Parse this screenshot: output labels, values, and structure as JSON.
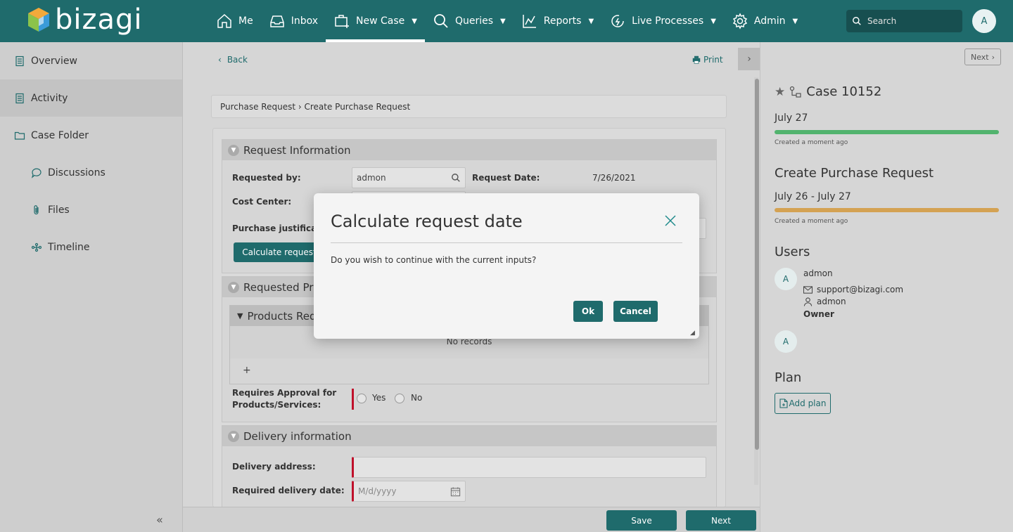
{
  "header": {
    "logo_text": "bizagi",
    "nav": [
      {
        "label": "Me",
        "icon": "home-icon",
        "caret": false
      },
      {
        "label": "Inbox",
        "icon": "inbox-icon",
        "caret": false
      },
      {
        "label": "New Case",
        "icon": "new-case-icon",
        "caret": true
      },
      {
        "label": "Queries",
        "icon": "search-icon",
        "caret": true
      },
      {
        "label": "Reports",
        "icon": "chart-icon",
        "caret": true
      },
      {
        "label": "Live Processes",
        "icon": "live-processes-icon",
        "caret": true
      },
      {
        "label": "Admin",
        "icon": "gear-icon",
        "caret": true
      }
    ],
    "caret": "▼",
    "search_placeholder": "Search",
    "avatar": "A"
  },
  "sidebar": {
    "items": [
      {
        "label": "Overview"
      },
      {
        "label": "Activity"
      },
      {
        "label": "Case Folder"
      },
      {
        "label": "Discussions"
      },
      {
        "label": "Files"
      },
      {
        "label": "Timeline"
      }
    ],
    "collapse": "«"
  },
  "main": {
    "back": "Back",
    "print": "Print",
    "breadcrumb": "Purchase Request › Create Purchase Request",
    "sections": {
      "request_info": "Request Information",
      "requested_products": "Requested Pro",
      "delivery": "Delivery information"
    },
    "fields": {
      "requested_by_label": "Requested by:",
      "requested_by_value": "admon",
      "request_date_label": "Request Date:",
      "request_date_value": "7/26/2021",
      "cost_center_label": "Cost Center:",
      "purchase_just_label": "Purchase justificatio",
      "calc_button": "Calculate request",
      "products_grid_title": "Products Req",
      "no_records": "No records",
      "add": "+",
      "requires_approval_label": "Requires Approval for Products/Services:",
      "yes": "Yes",
      "no": "No",
      "delivery_address_label": "Delivery address:",
      "required_delivery_label": "Required delivery date:",
      "date_placeholder": "M/d/yyyy"
    },
    "save": "Save",
    "next": "Next"
  },
  "right": {
    "next": "Next",
    "case_title": "Case 10152",
    "due_date": "July 27",
    "created1": "Created a moment ago",
    "activity_title": "Create Purchase Request",
    "activity_range": "July 26 - July 27",
    "created2": "Created a moment ago",
    "users_title": "Users",
    "user_name": "admon",
    "user_email": "support@bizagi.com",
    "user_login": "admon",
    "user_role": "Owner",
    "avatar": "A",
    "plan_title": "Plan",
    "add_plan": "Add plan",
    "colors": {
      "green": "#52b36e",
      "orange": "#d4a253"
    }
  },
  "modal": {
    "title": "Calculate request date",
    "message": "Do you wish to continue with the current inputs?",
    "ok": "Ok",
    "cancel": "Cancel"
  }
}
